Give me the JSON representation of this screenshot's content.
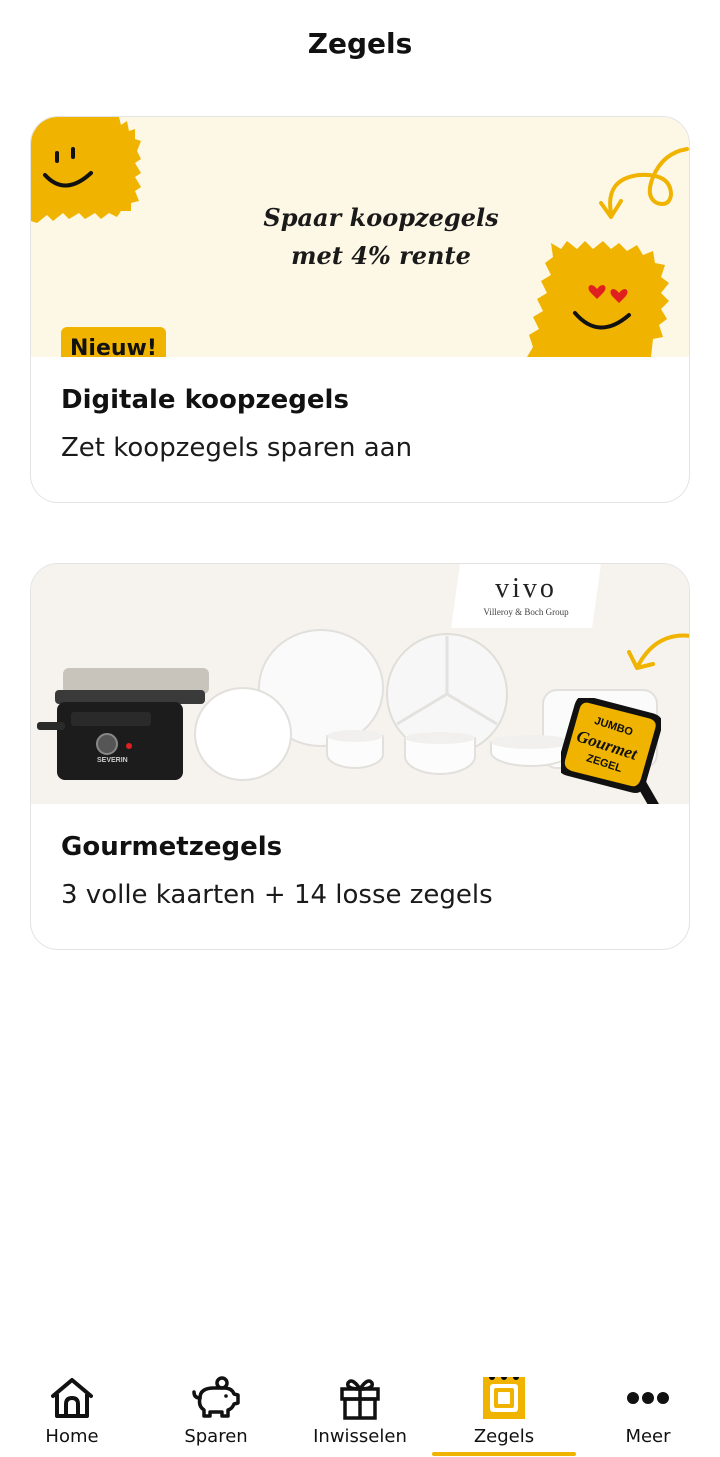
{
  "header": {
    "title": "Zegels"
  },
  "cards": [
    {
      "badge": "Nieuw!",
      "banner_text_line1": "Spaar koopzegels",
      "banner_text_line2": "met 4% rente",
      "title": "Digitale koopzegels",
      "subtitle": "Zet koopzegels sparen aan"
    },
    {
      "brand_logo": "vivo",
      "brand_tagline": "Villeroy & Boch Group",
      "grill_brand": "SEVERIN",
      "sticker_line1": "JUMBO",
      "sticker_line2": "Gourmet",
      "sticker_line3": "ZEGEL",
      "title": "Gourmetzegels",
      "subtitle": "3 volle kaarten + 14 losse zegels"
    }
  ],
  "tabbar": {
    "tabs": [
      {
        "label": "Home",
        "icon": "home-icon"
      },
      {
        "label": "Sparen",
        "icon": "piggy-bank-icon"
      },
      {
        "label": "Inwisselen",
        "icon": "gift-icon"
      },
      {
        "label": "Zegels",
        "icon": "stamp-icon",
        "active": true
      },
      {
        "label": "Meer",
        "icon": "more-icon"
      }
    ]
  },
  "colors": {
    "accent": "#f0b400",
    "banner_bg": "#fdf7e6",
    "text": "#111111"
  }
}
